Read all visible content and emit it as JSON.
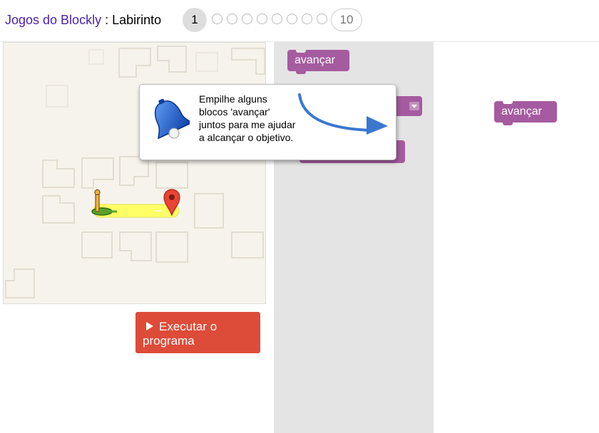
{
  "header": {
    "app_name": "Jogos do Blockly",
    "separator": " : ",
    "game_name": "Labirinto",
    "current_level": "1",
    "last_level": "10"
  },
  "run_button": {
    "label": "Executar o programa",
    "icon": "play-icon"
  },
  "toolbox": {
    "blocks": [
      {
        "label": "avançar"
      }
    ]
  },
  "workspace": {
    "blocks": [
      {
        "label": "avançar"
      }
    ]
  },
  "hint": {
    "text": "Empilhe alguns blocos 'avançar' juntos para me ajudar a alcançar o objetivo.",
    "icon": "bell-icon",
    "pointer": "arrow-icon"
  },
  "colors": {
    "title_link": "#4a1fb3",
    "run_button": "#dd4b39",
    "block": "#a55b9f",
    "toolbox_bg": "#e4e4e4",
    "maze_bg": "#f6f3ec",
    "path_highlight": "#ffff66"
  }
}
